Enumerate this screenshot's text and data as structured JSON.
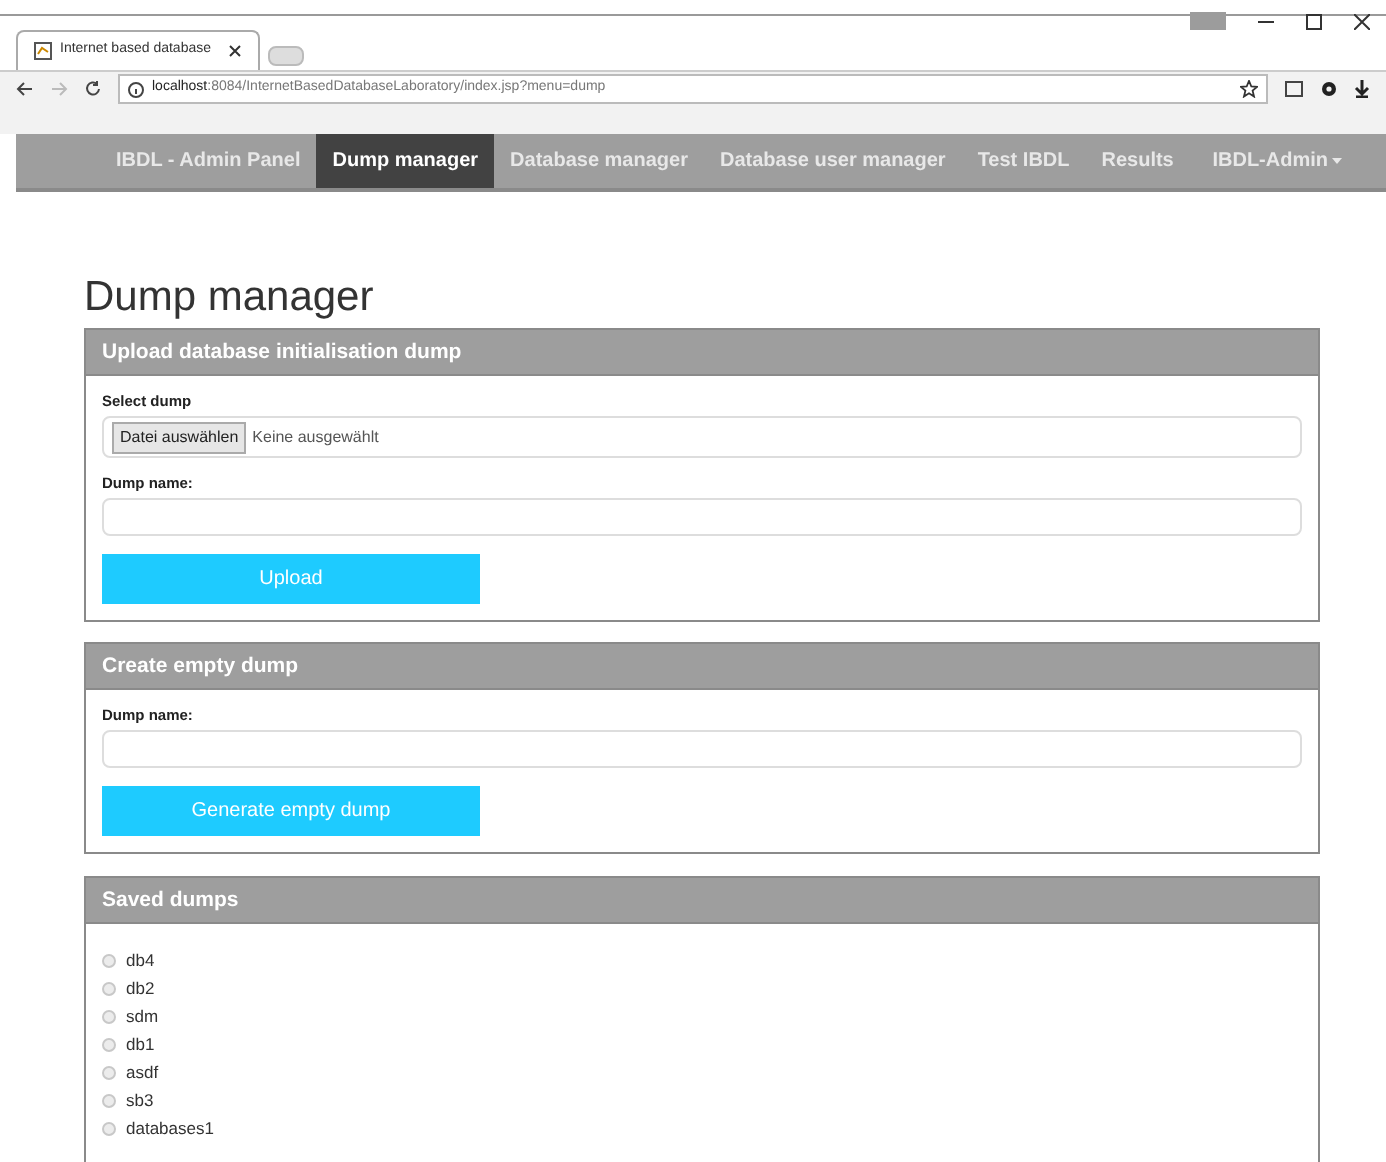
{
  "browser": {
    "tab_title": "Internet based database",
    "url_host": "localhost",
    "url_path": ":8084/InternetBasedDatabaseLaboratory/index.jsp?menu=dump"
  },
  "nav": {
    "items": [
      {
        "label": "IBDL - Admin Panel",
        "selected": false
      },
      {
        "label": "Dump manager",
        "selected": true
      },
      {
        "label": "Database manager",
        "selected": false
      },
      {
        "label": "Database user manager",
        "selected": false
      },
      {
        "label": "Test IBDL",
        "selected": false
      },
      {
        "label": "Results",
        "selected": false
      }
    ],
    "user_menu": "IBDL-Admin"
  },
  "page_title": "Dump manager",
  "upload_panel": {
    "title": "Upload database initialisation dump",
    "select_label": "Select dump",
    "file_button": "Datei auswählen",
    "file_status": "Keine ausgewählt",
    "name_label": "Dump name:",
    "button": "Upload"
  },
  "empty_panel": {
    "title": "Create empty dump",
    "name_label": "Dump name:",
    "button": "Generate empty dump"
  },
  "saved_panel": {
    "title": "Saved dumps",
    "dumps": [
      {
        "label": "db4",
        "selected": false
      },
      {
        "label": "db2",
        "selected": false
      },
      {
        "label": "sdm",
        "selected": false
      },
      {
        "label": "db1",
        "selected": false
      },
      {
        "label": "asdf",
        "selected": false
      },
      {
        "label": "sb3",
        "selected": false
      },
      {
        "label": "databases1",
        "selected": false
      }
    ]
  }
}
